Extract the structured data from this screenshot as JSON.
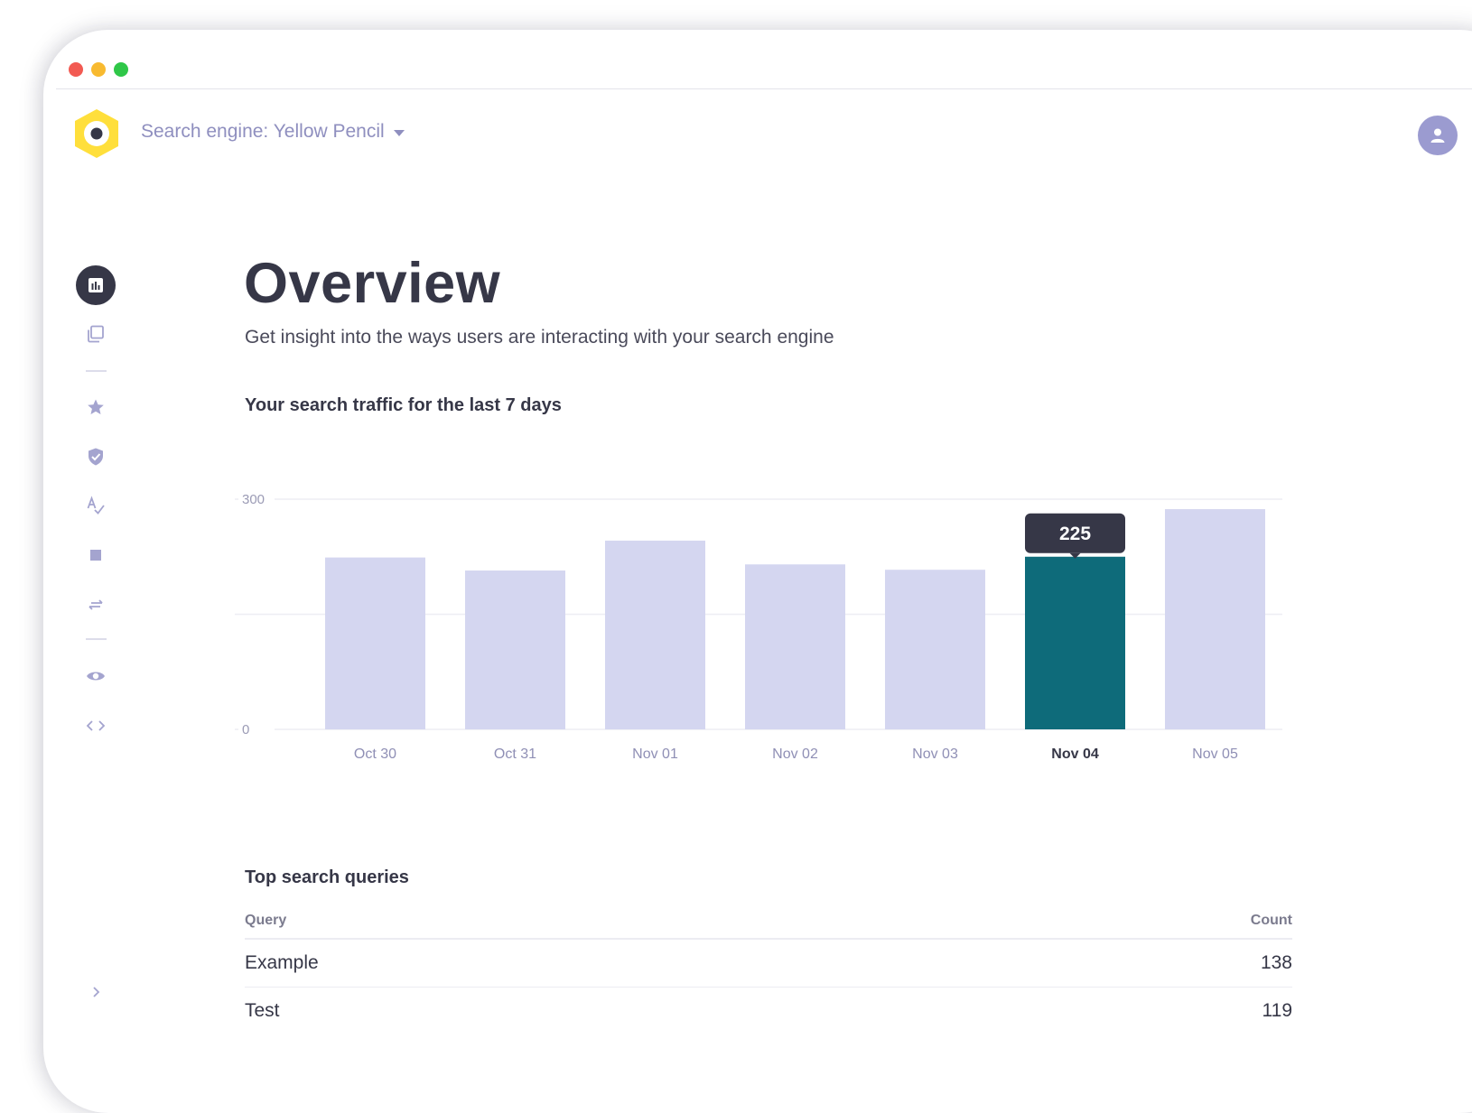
{
  "window": {
    "traffic_lights": [
      {
        "name": "close",
        "color": "#f25a52"
      },
      {
        "name": "minimize",
        "color": "#f8ba30"
      },
      {
        "name": "maximize",
        "color": "#2fc748"
      }
    ]
  },
  "header": {
    "logo_icon": "hexagon-logo-icon",
    "engine_label": "Search engine: Yellow Pencil",
    "dropdown_icon": "caret-down-icon",
    "avatar_icon": "user-icon"
  },
  "sidebar": {
    "items": [
      {
        "icon": "bar-chart-icon",
        "active": true
      },
      {
        "icon": "documents-icon",
        "active": false
      },
      {
        "icon": "star-icon",
        "active": false
      },
      {
        "icon": "shield-check-icon",
        "active": false
      },
      {
        "icon": "spellcheck-icon",
        "active": false
      },
      {
        "icon": "square-icon",
        "active": false
      },
      {
        "icon": "swap-arrows-icon",
        "active": false
      },
      {
        "icon": "eye-icon",
        "active": false
      },
      {
        "icon": "code-icon",
        "active": false
      }
    ],
    "expand_icon": "chevron-right-icon"
  },
  "main": {
    "title": "Overview",
    "subtitle": "Get insight into the ways users are interacting with your search engine",
    "traffic_title": "Your search traffic for the last 7 days",
    "queries_title": "Top search queries"
  },
  "chart_data": {
    "type": "bar",
    "categories": [
      "Oct 30",
      "Oct 31",
      "Nov 01",
      "Nov 02",
      "Nov 03",
      "Nov 04",
      "Nov 05"
    ],
    "values": [
      224,
      207,
      246,
      215,
      208,
      225,
      287
    ],
    "highlighted_index": 5,
    "tooltip": "225",
    "yticks": [
      "300",
      "0"
    ],
    "ylim": [
      0,
      300
    ],
    "gridlines": [
      0,
      150,
      300
    ],
    "bar_color": "#d4d6f0",
    "highlight_color": "#0e6b7a",
    "tooltip_color": "#363747"
  },
  "queries_table": {
    "headers": {
      "query": "Query",
      "count": "Count"
    },
    "rows": [
      {
        "query": "Example",
        "count": "138"
      },
      {
        "query": "Test",
        "count": "119"
      }
    ]
  }
}
